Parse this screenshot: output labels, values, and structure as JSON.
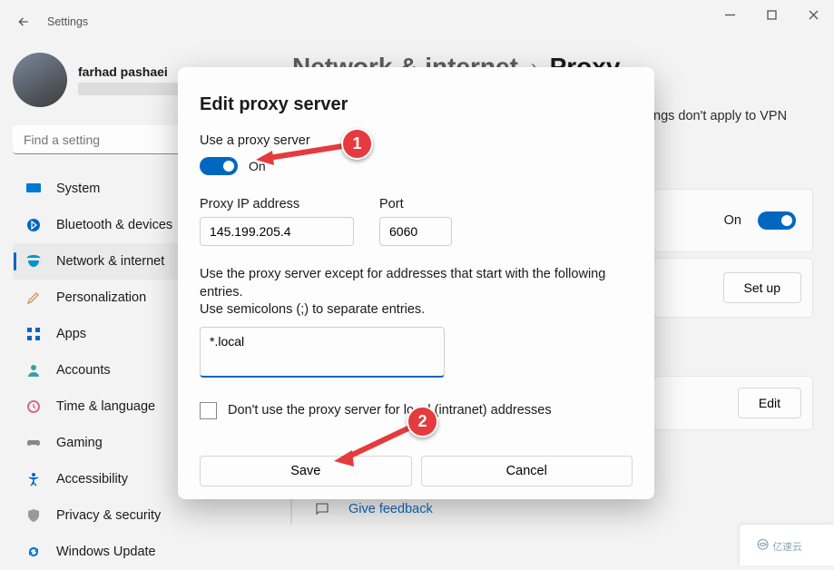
{
  "titlebar": {
    "title": "Settings"
  },
  "profile": {
    "name": "farhad pashaei"
  },
  "search": {
    "placeholder": "Find a setting"
  },
  "nav": {
    "system": "System",
    "bluetooth": "Bluetooth & devices",
    "network": "Network & internet",
    "personalization": "Personalization",
    "apps": "Apps",
    "accounts": "Accounts",
    "time": "Time & language",
    "gaming": "Gaming",
    "accessibility": "Accessibility",
    "privacy": "Privacy & security",
    "update": "Windows Update"
  },
  "breadcrumb": {
    "a": "Network & internet",
    "b": "Proxy"
  },
  "bg": {
    "vpn_hint": "ngs don't apply to VPN",
    "on_label": "On",
    "setup_btn": "Set up",
    "edit_btn": "Edit",
    "feedback": "Give feedback"
  },
  "modal": {
    "title": "Edit proxy server",
    "use_proxy_label": "Use a proxy server",
    "toggle_state": "On",
    "ip_label": "Proxy IP address",
    "ip_value": "145.199.205.4",
    "port_label": "Port",
    "port_value": "6060",
    "desc_line1": "Use the proxy server except for addresses that start with the following entries.",
    "desc_line2": "Use semicolons (;) to separate entries.",
    "exceptions_value": "*.local",
    "local_checkbox": "Don't use the proxy server for local (intranet) addresses",
    "save": "Save",
    "cancel": "Cancel"
  },
  "markers": {
    "one": "1",
    "two": "2"
  },
  "watermark": "亿速云"
}
